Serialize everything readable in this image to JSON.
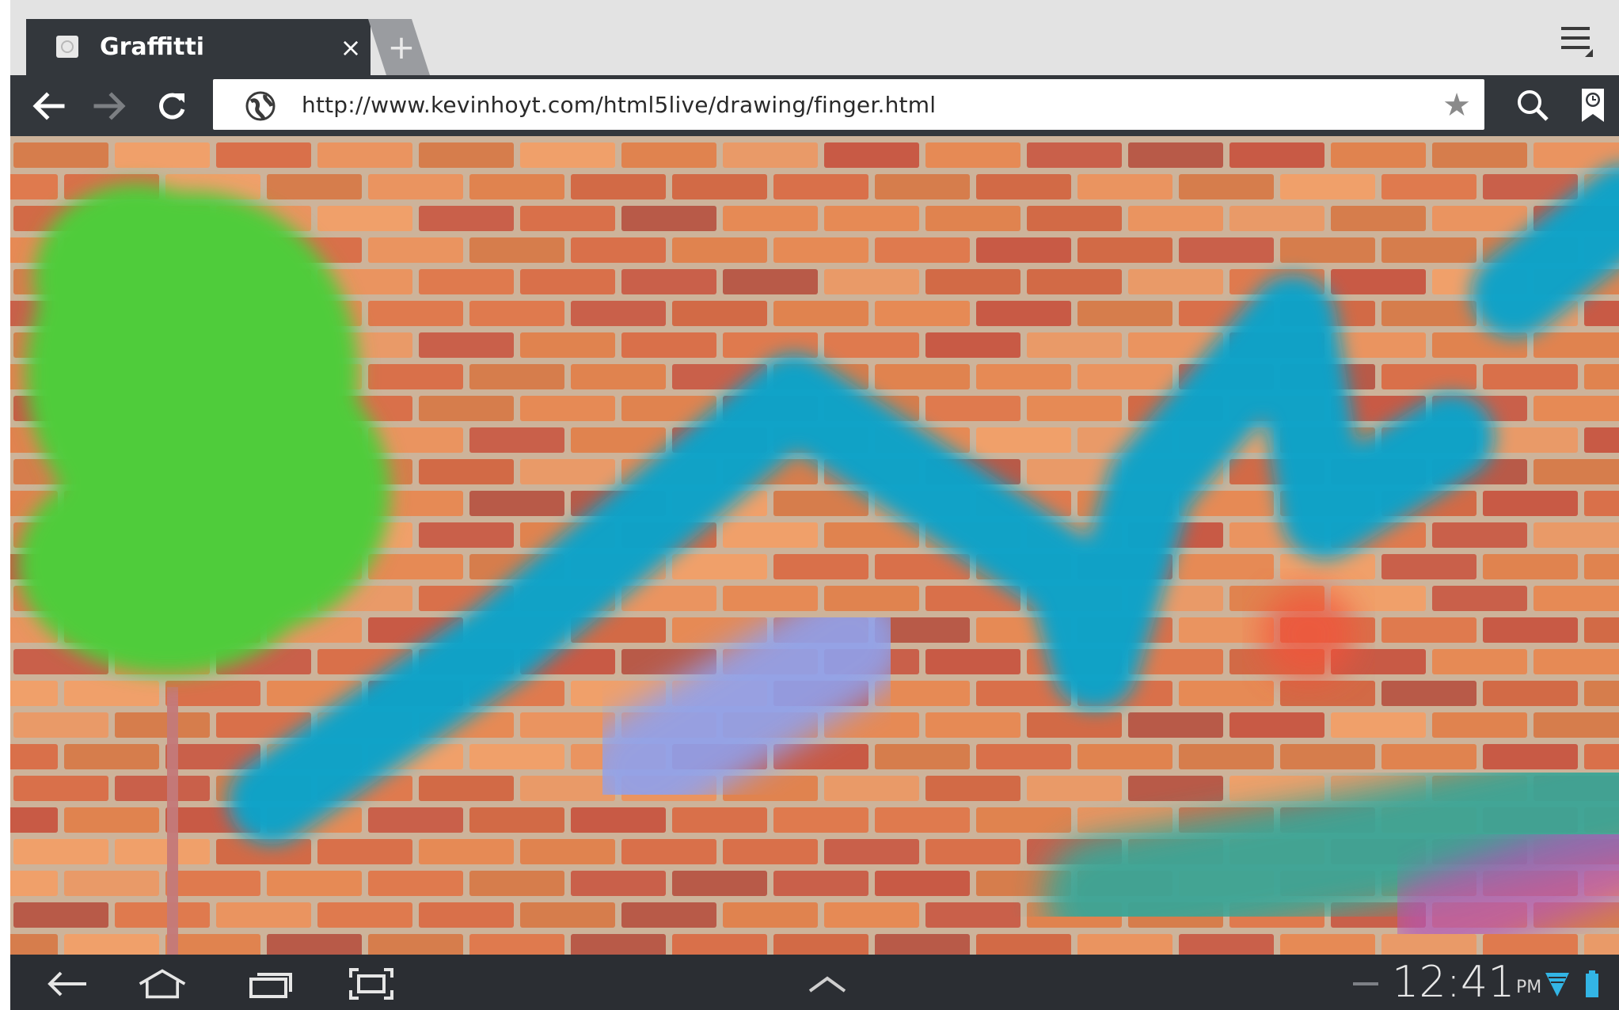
{
  "browser": {
    "tab": {
      "title": "Graffitti",
      "close_glyph": "×",
      "favicon": "page-favicon-icon"
    },
    "new_tab_glyph": "+",
    "menu_icon": "overflow-menu-icon",
    "nav": {
      "back_icon": "back-arrow-icon",
      "forward_icon": "forward-arrow-icon",
      "reload_icon": "reload-icon"
    },
    "url": "http://www.kevinhoyt.com/html5live/drawing/finger.html",
    "bookmark_star_glyph": "★",
    "search_icon": "search-icon",
    "bookmarks_icon": "bookmarks-icon"
  },
  "canvas": {
    "background": "brick-wall",
    "strokes": [
      {
        "name": "green-tree-crown",
        "color": "#4fcc3a"
      },
      {
        "name": "tree-trunk",
        "color": "#c47a7a"
      },
      {
        "name": "blue-zigzag",
        "color": "#0aa3c9"
      },
      {
        "name": "lavender-stroke",
        "color": "#8fa1ee"
      },
      {
        "name": "teal-stroke",
        "color": "#3aa596"
      },
      {
        "name": "red-dab",
        "color": "#f2533a"
      },
      {
        "name": "purple-stroke",
        "color": "#b255b8"
      }
    ]
  },
  "system_bar": {
    "back_icon": "system-back-icon",
    "home_icon": "system-home-icon",
    "recents_icon": "system-recents-icon",
    "screenshot_icon": "system-screenshot-icon",
    "up_icon": "chevron-up-icon",
    "time": "12:41",
    "ampm": "PM",
    "wifi_icon": "wifi-icon",
    "battery_icon": "battery-icon"
  }
}
